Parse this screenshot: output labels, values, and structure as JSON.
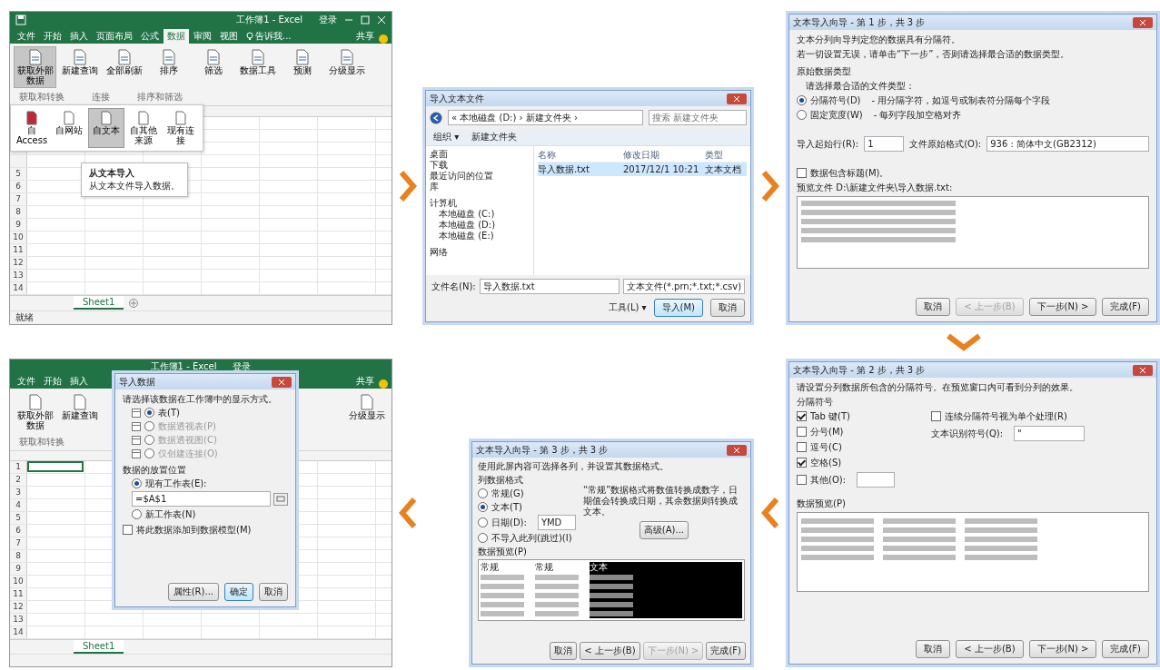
{
  "excel_data_tab": {
    "title": "工作簿1 - Excel",
    "account": "登录",
    "tabs": [
      {
        "label": "文件",
        "selected": false
      },
      {
        "label": "开始",
        "selected": false
      },
      {
        "label": "插入",
        "selected": false
      },
      {
        "label": "页面布局",
        "selected": false
      },
      {
        "label": "公式",
        "selected": false
      },
      {
        "label": "数据",
        "selected": true
      },
      {
        "label": "审阅",
        "selected": false
      },
      {
        "label": "视图",
        "selected": false
      }
    ],
    "tell_me": "告诉我...",
    "share": "共享",
    "ribbon_buttons": [
      {
        "label": "获取外部数据",
        "selected": true
      },
      {
        "label": "新建查询",
        "selected": false
      },
      {
        "label": "全部刷新",
        "selected": false
      },
      {
        "label": "排序",
        "selected": false
      },
      {
        "label": "筛选",
        "selected": false
      },
      {
        "label": "数据工具",
        "selected": false
      },
      {
        "label": "预测",
        "selected": false
      },
      {
        "label": "分级显示",
        "selected": false
      }
    ],
    "group_labels": [
      "获取和转换",
      "连接",
      "排序和筛选"
    ],
    "dropdown_items": [
      {
        "label": "自 Access",
        "selected": false
      },
      {
        "label": "自网站",
        "selected": false
      },
      {
        "label": "自文本",
        "selected": true
      },
      {
        "label": "自其他来源",
        "selected": false
      },
      {
        "label": "现有连接",
        "selected": false
      }
    ],
    "tooltip": {
      "title": "从文本导入",
      "text": "从文本文件导入数据。"
    },
    "row_numbers": [
      "5",
      "6",
      "7",
      "8",
      "9",
      "10",
      "11",
      "12",
      "13",
      "14"
    ],
    "sheet_tab": "Sheet1",
    "status": "就绪"
  },
  "open_dialog": {
    "title": "导入文本文件",
    "path": "« 本地磁盘 (D:) › 新建文件夹 ›",
    "search_placeholder": "搜索 新建文件夹",
    "toolbar": [
      "组织 ▾",
      "新建文件夹"
    ],
    "favorites": [
      "桌面",
      "下载",
      "最近访问的位置",
      "库"
    ],
    "computer": "计算机",
    "drives": [
      "本地磁盘 (C:)",
      "本地磁盘 (D:)",
      "本地磁盘 (E:)"
    ],
    "network": "网络",
    "columns": [
      "名称",
      "修改日期",
      "类型"
    ],
    "files": [
      {
        "name": "导入数据.txt",
        "date": "2017/12/1 10:21",
        "type": "文本文档",
        "selected": true
      }
    ],
    "filename_label": "文件名(N):",
    "filename": "导入数据.txt",
    "filter": "文本文件(*.prn;*.txt;*.csv)",
    "tools": "工具(L) ▾",
    "buttons": [
      "导入(M)",
      "取消"
    ]
  },
  "wizard_step1": {
    "title": "文本导入向导 - 第 1 步，共 3 步",
    "lines": [
      "文本分列向导判定您的数据具有分隔符。",
      "若一切设置无误，请单击“下一步”，否则请选择最合适的数据类型。"
    ],
    "section": "原始数据类型",
    "prompt": "请选择最合适的文件类型：",
    "options": [
      {
        "label": "分隔符号(D)",
        "description": "- 用分隔字符，如逗号或制表符分隔每个字段",
        "selected": true
      },
      {
        "label": "固定宽度(W)",
        "description": "- 每列字段加空格对齐",
        "selected": false
      }
    ],
    "start_row_label": "导入起始行(R):",
    "start_row": "1",
    "origin_label": "文件原始格式(O):",
    "origin": "936 : 简体中文(GB2312)",
    "header_checkbox": {
      "label": "数据包含标题(M)。",
      "checked": false
    },
    "preview_label": "预览文件 D:\\新建文件夹\\导入数据.txt:",
    "buttons": [
      {
        "label": "取消",
        "disabled": false
      },
      {
        "label": "< 上一步(B)",
        "disabled": true
      },
      {
        "label": "下一步(N) >",
        "disabled": false
      },
      {
        "label": "完成(F)",
        "disabled": false
      }
    ]
  },
  "wizard_step2": {
    "title": "文本导入向导 - 第 2 步，共 3 步",
    "intro": "请设置分列数据所包含的分隔符号。在预览窗口内可看到分列的效果。",
    "section": "分隔符号",
    "delimiters": [
      {
        "label": "Tab 键(T)",
        "checked": true
      },
      {
        "label": "分号(M)",
        "checked": false
      },
      {
        "label": "逗号(C)",
        "checked": false
      },
      {
        "label": "空格(S)",
        "checked": true
      },
      {
        "label": "其他(O):",
        "checked": false
      }
    ],
    "consecutive": {
      "label": "连续分隔符号视为单个处理(R)",
      "checked": false
    },
    "qualifier_label": "文本识别符号(Q):",
    "qualifier": "\"",
    "preview_label": "数据预览(P)",
    "buttons": [
      {
        "label": "取消",
        "disabled": false
      },
      {
        "label": "< 上一步(B)",
        "disabled": false
      },
      {
        "label": "下一步(N) >",
        "disabled": false
      },
      {
        "label": "完成(F)",
        "disabled": false
      }
    ]
  },
  "wizard_step3": {
    "title": "文本导入向导 - 第 3 步，共 3 步",
    "intro": "使用此屏内容可选择各列，并设置其数据格式。",
    "section": "列数据格式",
    "formats": [
      {
        "label": "常规(G)",
        "selected": false
      },
      {
        "label": "文本(T)",
        "selected": true
      },
      {
        "label": "日期(D):",
        "selected": false
      },
      {
        "label": "不导入此列(跳过)(I)",
        "selected": false
      }
    ],
    "date_order": "YMD",
    "note": "“常规”数据格式将数值转换成数字，日期值会转换成日期，其余数据则转换成文本。",
    "advanced": "高级(A)...",
    "preview_label": "数据预览(P)",
    "preview_headers": [
      "常规",
      "常规",
      "文本"
    ],
    "buttons": [
      {
        "label": "取消",
        "disabled": false
      },
      {
        "label": "< 上一步(B)",
        "disabled": false
      },
      {
        "label": "下一步(N) >",
        "disabled": true
      },
      {
        "label": "完成(F)",
        "disabled": false
      }
    ]
  },
  "excel_import": {
    "title": "工作簿1 - Excel",
    "account": "登录",
    "tabs": [
      {
        "label": "文件",
        "selected": false
      },
      {
        "label": "开始",
        "selected": false
      },
      {
        "label": "插入",
        "selected": false
      }
    ],
    "share": "共享",
    "ribbon_buttons": [
      "获取外部数据",
      "新建查询"
    ],
    "group_label": "获取和转换",
    "right_button": "分级显示",
    "row_numbers": [
      "1",
      "2",
      "3",
      "4",
      "5",
      "6",
      "7",
      "8",
      "9",
      "10",
      "11",
      "12",
      "13",
      "14"
    ],
    "sheet_tab": "Sheet1",
    "dialog": {
      "title": "导入数据",
      "prompt": "请选择该数据在工作簿中的显示方式。",
      "views": [
        {
          "label": "表(T)",
          "selected": true,
          "disabled": false
        },
        {
          "label": "数据透视表(P)",
          "selected": false,
          "disabled": true
        },
        {
          "label": "数据透视图(C)",
          "selected": false,
          "disabled": true
        },
        {
          "label": "仅创建连接(O)",
          "selected": false,
          "disabled": true
        }
      ],
      "location_label": "数据的放置位置",
      "placements": [
        {
          "label": "现有工作表(E):",
          "selected": true
        },
        {
          "label": "新工作表(N)",
          "selected": false
        }
      ],
      "range": "=$A$1",
      "model_checkbox": {
        "label": "将此数据添加到数据模型(M)",
        "checked": false
      },
      "buttons": [
        "属性(R)...",
        "确定",
        "取消"
      ]
    }
  }
}
